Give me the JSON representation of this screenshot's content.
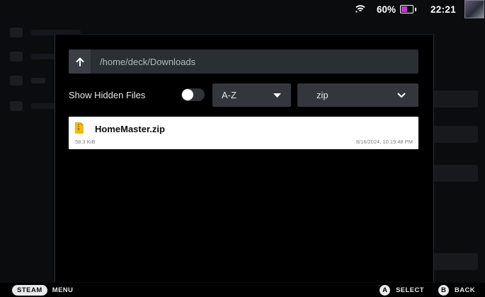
{
  "status": {
    "battery_percent": "60%",
    "battery_level": 0.6,
    "battery_color": "#c533d8",
    "time": "22:21",
    "icons": [
      "wifi-icon",
      "battery-icon",
      "avatar"
    ]
  },
  "dialog": {
    "path": "/home/deck/Downloads",
    "up_icon": "arrow-up-icon",
    "show_hidden_label": "Show Hidden Files",
    "show_hidden_enabled": false,
    "sort_value": "A-Z",
    "sort_icon": "caret-down-icon",
    "extension_value": "zip",
    "extension_icon": "chevron-down-icon"
  },
  "files": [
    {
      "name": "HomeMaster.zip",
      "size": "58.3 KiB",
      "modified": "8/16/2024, 10:19:48 PM",
      "icon": "zip-file-icon",
      "icon_color": "#f2b90f"
    }
  ],
  "footer": {
    "steam_label": "STEAM",
    "menu_label": "MENU",
    "a_glyph": "A",
    "select_label": "SELECT",
    "b_glyph": "B",
    "back_label": "BACK"
  }
}
